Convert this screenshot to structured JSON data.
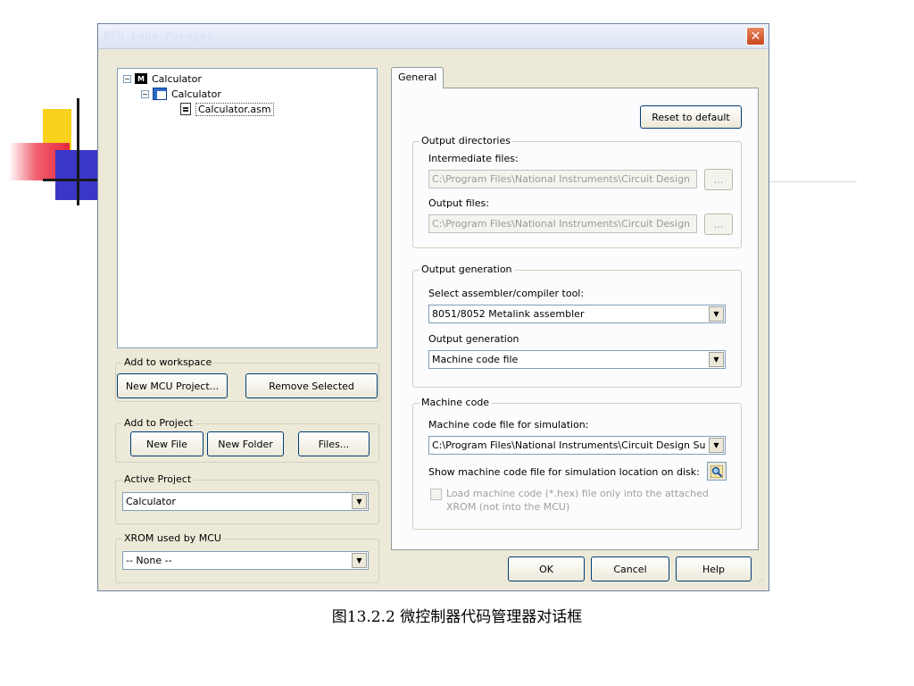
{
  "window": {
    "title": "MCU Code Manager"
  },
  "tree": {
    "items": [
      {
        "label": "Calculator",
        "icon": "chip-icon",
        "expander": "−"
      },
      {
        "label": "Calculator",
        "icon": "project-icon",
        "expander": "−"
      },
      {
        "label": "Calculator.asm",
        "icon": "file-icon"
      }
    ]
  },
  "workspace": {
    "group_label": "Add to workspace",
    "new_project": "New MCU Project...",
    "remove_selected": "Remove Selected"
  },
  "project": {
    "group_label": "Add to Project",
    "new_file": "New File",
    "new_folder": "New Folder",
    "files": "Files..."
  },
  "active_project": {
    "group_label": "Active Project",
    "value": "Calculator"
  },
  "xrom": {
    "group_label": "XROM used by MCU",
    "value": "-- None --"
  },
  "tab": {
    "label": "General"
  },
  "general": {
    "reset_button": "Reset to default",
    "output_directories": {
      "group_label": "Output directories",
      "intermediate_label": "Intermediate files:",
      "intermediate_value": "C:\\Program Files\\National Instruments\\Circuit Design S",
      "output_label": "Output files:",
      "output_value": "C:\\Program Files\\National Instruments\\Circuit Design S",
      "browse": "..."
    },
    "output_generation": {
      "group_label": "Output generation",
      "tool_label": "Select assembler/compiler tool:",
      "tool_value": "8051/8052 Metalink assembler",
      "gen_label": "Output generation",
      "gen_value": "Machine code file"
    },
    "machine_code": {
      "group_label": "Machine code",
      "sim_label": "Machine code file for simulation:",
      "sim_value": "C:\\Program Files\\National Instruments\\Circuit Design Sui",
      "show_label": "Show machine code file for simulation location on disk:",
      "load_label_line1": "Load machine code (*.hex) file only into the attached",
      "load_label_line2": "XROM (not into the MCU)"
    }
  },
  "buttons": {
    "ok": "OK",
    "cancel": "Cancel",
    "help": "Help"
  },
  "caption": "图13.2.2 微控制器代码管理器对话框"
}
